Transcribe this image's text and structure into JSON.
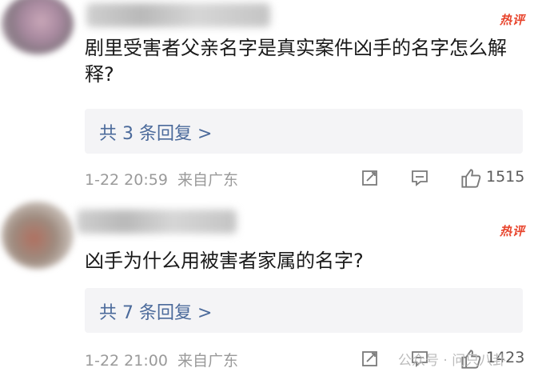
{
  "comments": [
    {
      "hot_badge": "热评",
      "text": "剧里受害者父亲名字是真实案件凶手的名字怎么解释?",
      "replies_label": "共 3 条回复 >",
      "timestamp": "1-22 20:59",
      "location": "来自广东",
      "like_count": "1515"
    },
    {
      "hot_badge": "热评",
      "text": "凶手为什么用被害者家属的名字?",
      "replies_label": "共 7 条回复 >",
      "timestamp": "1-22 21:00",
      "location": "来自广东",
      "like_count": "1423"
    }
  ],
  "watermark": "公众号 · 问只八卦",
  "colors": {
    "hot": "#e8452d",
    "link": "#4b6a9b",
    "meta": "#9a9a9a",
    "reply_bg": "#f4f4f6"
  },
  "icons": [
    "share-icon",
    "comment-icon",
    "like-icon"
  ]
}
